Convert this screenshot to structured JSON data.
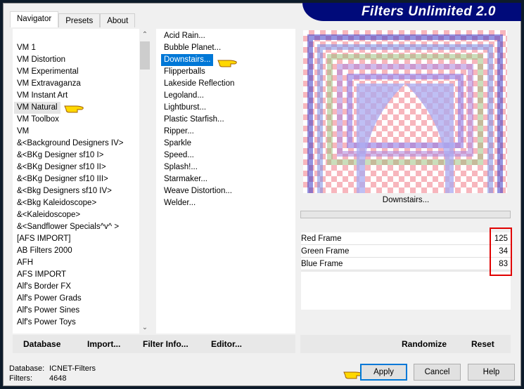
{
  "title": "Filters Unlimited 2.0",
  "tabs": [
    "Navigator",
    "Presets",
    "About"
  ],
  "categories": [
    "VM 1",
    "VM Distortion",
    "VM Experimental",
    "VM Extravaganza",
    "VM Instant Art",
    "VM Natural",
    "VM Toolbox",
    "VM",
    "&<Background Designers IV>",
    "&<BKg Designer sf10 I>",
    "&<BKg Designer sf10 II>",
    "&<BKg Designer sf10 III>",
    "&<Bkg Designers sf10 IV>",
    "&<Bkg Kaleidoscope>",
    "&<Kaleidoscope>",
    "&<Sandflower Specials^v^ >",
    "[AFS IMPORT]",
    "AB Filters 2000",
    "AFH",
    "AFS IMPORT",
    "Alf's Border FX",
    "Alf's Power Grads",
    "Alf's Power Sines",
    "Alf's Power Toys"
  ],
  "selected_category": "VM Natural",
  "filters": [
    "Acid Rain...",
    "Bubble Planet...",
    "Downstairs...",
    "Flipperballs",
    "Lakeside Reflection",
    "Legoland...",
    "Lightburst...",
    "Plastic Starfish...",
    "Ripper...",
    "Sparkle",
    "Speed...",
    "Splash!...",
    "Starmaker...",
    "Weave Distortion...",
    "Welder..."
  ],
  "selected_filter": "Downstairs...",
  "preview_label": "Downstairs...",
  "params": [
    {
      "label": "Red Frame",
      "value": "125"
    },
    {
      "label": "Green Frame",
      "value": "34"
    },
    {
      "label": "Blue Frame",
      "value": "83"
    }
  ],
  "toolbar": {
    "database": "Database",
    "import": "Import...",
    "filter_info": "Filter Info...",
    "editor": "Editor...",
    "randomize": "Randomize",
    "reset": "Reset"
  },
  "status": {
    "database_label": "Database:",
    "database_value": "ICNET-Filters",
    "filters_label": "Filters:",
    "filters_value": "4648"
  },
  "buttons": {
    "apply": "Apply",
    "cancel": "Cancel",
    "help": "Help"
  },
  "colors": {
    "selection": "#0078d7",
    "banner": "#000a7a",
    "highlight_box": "#e00000"
  }
}
